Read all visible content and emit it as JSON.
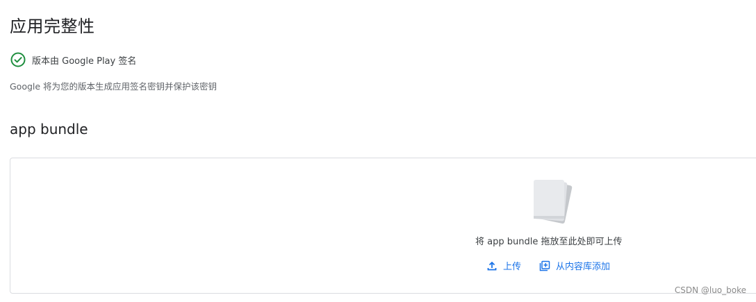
{
  "integrity": {
    "title": "应用完整性",
    "status_text": "版本由 Google Play 签名",
    "description": "Google 将为您的版本生成应用签名密钥并保护该密钥"
  },
  "bundle": {
    "title": "app bundle",
    "drop_label": "将 app bundle 拖放至此处即可上传",
    "upload_label": "上传",
    "library_label": "从内容库添加"
  },
  "watermark": "CSDN @luo_boke",
  "colors": {
    "success_green": "#1e8e3e",
    "link_blue": "#1a73e8",
    "border": "#dadce0"
  }
}
